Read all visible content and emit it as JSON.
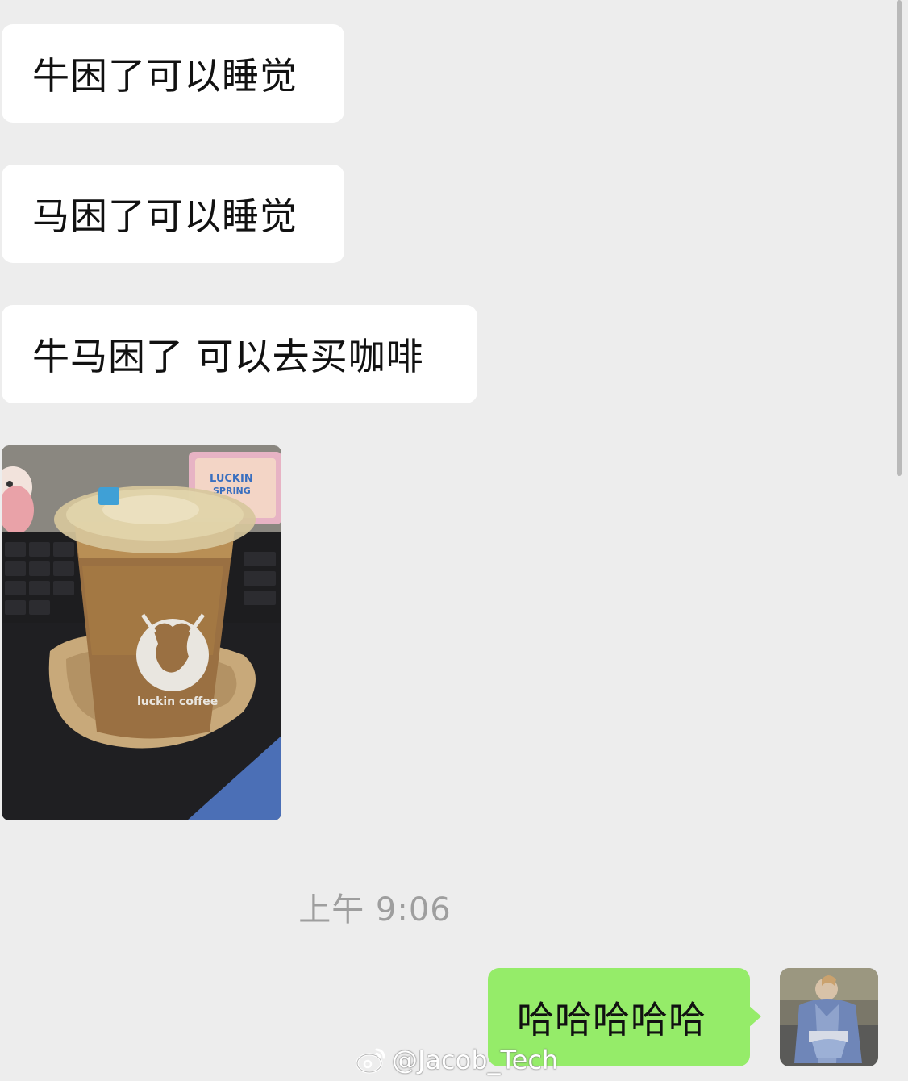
{
  "messages": {
    "incoming": [
      {
        "text": "牛困了可以睡觉"
      },
      {
        "text": "马困了可以睡觉"
      },
      {
        "text": "牛马困了 可以去买咖啡"
      }
    ],
    "photo_logo_text": "luckin coffee",
    "photo_sign_text": "LUCKIN SPRING",
    "timestamp": "上午 9:06",
    "outgoing": [
      {
        "text": "哈哈哈哈哈"
      }
    ]
  },
  "watermark": {
    "icon": "weibo-icon",
    "text": "@Jacob_Tech"
  },
  "colors": {
    "background": "#ededed",
    "incoming_bubble": "#ffffff",
    "outgoing_bubble": "#95ec69",
    "timestamp": "#9e9e9e"
  }
}
